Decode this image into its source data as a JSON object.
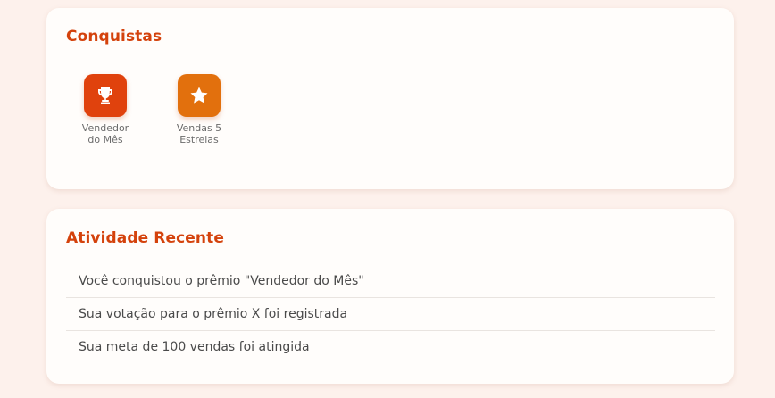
{
  "achievements": {
    "title": "Conquistas",
    "badges": [
      {
        "label_line1": "Vendedor",
        "label_line2": "do Mês",
        "icon": "trophy-icon",
        "color": "#e0420d"
      },
      {
        "label_line1": "Vendas 5",
        "label_line2": "Estrelas",
        "icon": "star-icon",
        "color": "#e2700d"
      }
    ]
  },
  "activity": {
    "title": "Atividade Recente",
    "items": [
      "Você conquistou o prêmio \"Vendedor do Mês\"",
      "Sua votação para o prêmio X foi registrada",
      "Sua meta de 100 vendas foi atingida"
    ]
  },
  "colors": {
    "accent": "#d4420c",
    "background": "#fdf1ec",
    "card": "#fffdfb"
  }
}
